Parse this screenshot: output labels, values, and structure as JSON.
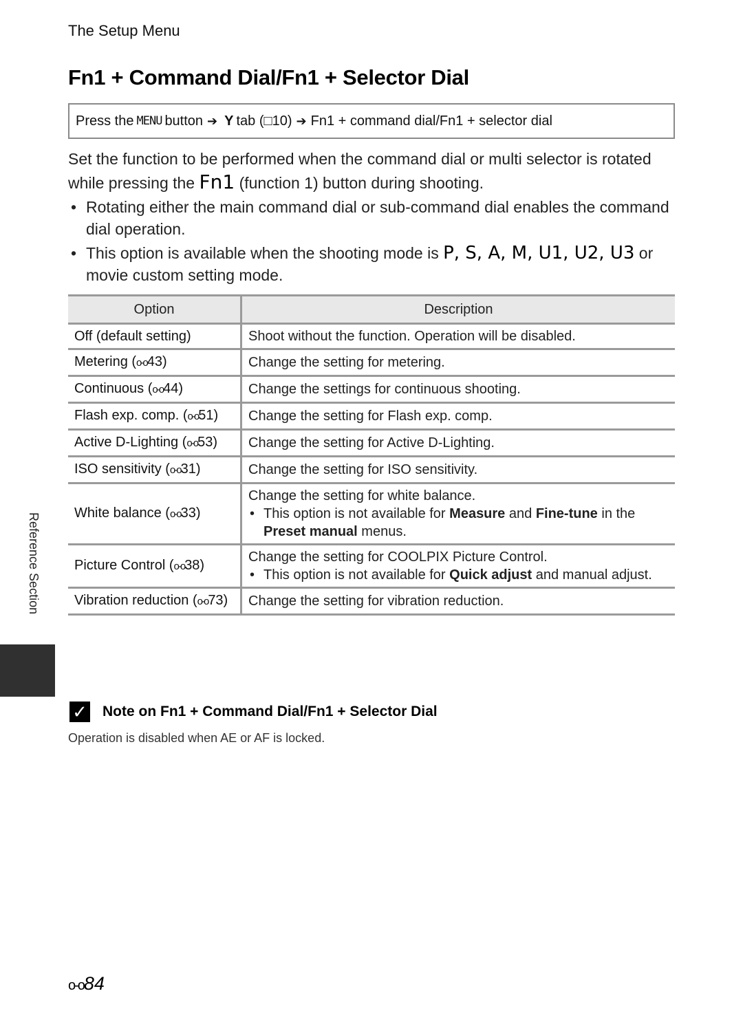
{
  "running_head": "The Setup Menu",
  "title": "Fn1 + Command Dial/Fn1 + Selector Dial",
  "nav_path": {
    "press": "Press the",
    "menu_key": "MENU",
    "button": "button",
    "arrow_icon": "➔",
    "wrench_icon": "Y",
    "tab": "tab (",
    "book_icon": "□",
    "page_ref": "10)",
    "item": "Fn1 + command dial/Fn1 + selector dial"
  },
  "intro": {
    "line1": "Set the function to be performed when the command dial or multi selector is rotated while pressing the",
    "fn_key": "Fn1",
    "line2": "(function 1) button during shooting.",
    "bullet1": "Rotating either the main command dial or sub-command dial enables the command dial operation.",
    "bullet2_pre": "This option is available when the shooting mode is",
    "modes": "P, S, A, M, U1, U2, U3",
    "bullet2_post": "or movie custom setting mode."
  },
  "table": {
    "headers": [
      "Option",
      "Description"
    ],
    "ref_glyph": "o-o",
    "rows": [
      {
        "option": "Off (default setting)",
        "ref": "",
        "desc": "Shoot without the function. Operation will be disabled.",
        "note": null
      },
      {
        "option": "Metering (",
        "ref": "43)",
        "desc": "Change the setting for metering.",
        "note": null
      },
      {
        "option": "Continuous (",
        "ref": "44)",
        "desc": "Change the settings for continuous shooting.",
        "note": null
      },
      {
        "option": "Flash exp. comp. (",
        "ref": "51)",
        "desc": "Change the setting for Flash exp. comp.",
        "note": null
      },
      {
        "option": "Active D-Lighting (",
        "ref": "53)",
        "desc": "Change the setting for Active D-Lighting.",
        "note": null
      },
      {
        "option": "ISO sensitivity (",
        "ref": "31)",
        "desc": "Change the setting for ISO sensitivity.",
        "note": null
      },
      {
        "option": "White balance (",
        "ref": "33)",
        "desc": "Change the setting for white balance.",
        "note": {
          "pre": "This option is not available for",
          "b1": "Measure",
          "mid": "and",
          "b2": "Fine-tune",
          "mid2": "in the",
          "b3": "Preset manual",
          "post": "menus."
        }
      },
      {
        "option": "Picture Control (",
        "ref": "38)",
        "desc": "Change the setting for COOLPIX Picture Control.",
        "note": {
          "pre": "This option is not available for",
          "b1": "Quick adjust",
          "mid": "and manual adjust.",
          "b2": "",
          "mid2": "",
          "b3": "",
          "post": ""
        }
      },
      {
        "option": "Vibration reduction (",
        "ref": "73)",
        "desc": "Change the setting for vibration reduction.",
        "note": null
      }
    ]
  },
  "note": {
    "icon": "check-icon",
    "heading": "Note on Fn1 + Command Dial/Fn1 + Selector Dial",
    "body": "Operation is disabled when AE or AF is locked."
  },
  "side_label": "Reference Section",
  "page_number": {
    "glyph": "o-o",
    "num": "84"
  }
}
